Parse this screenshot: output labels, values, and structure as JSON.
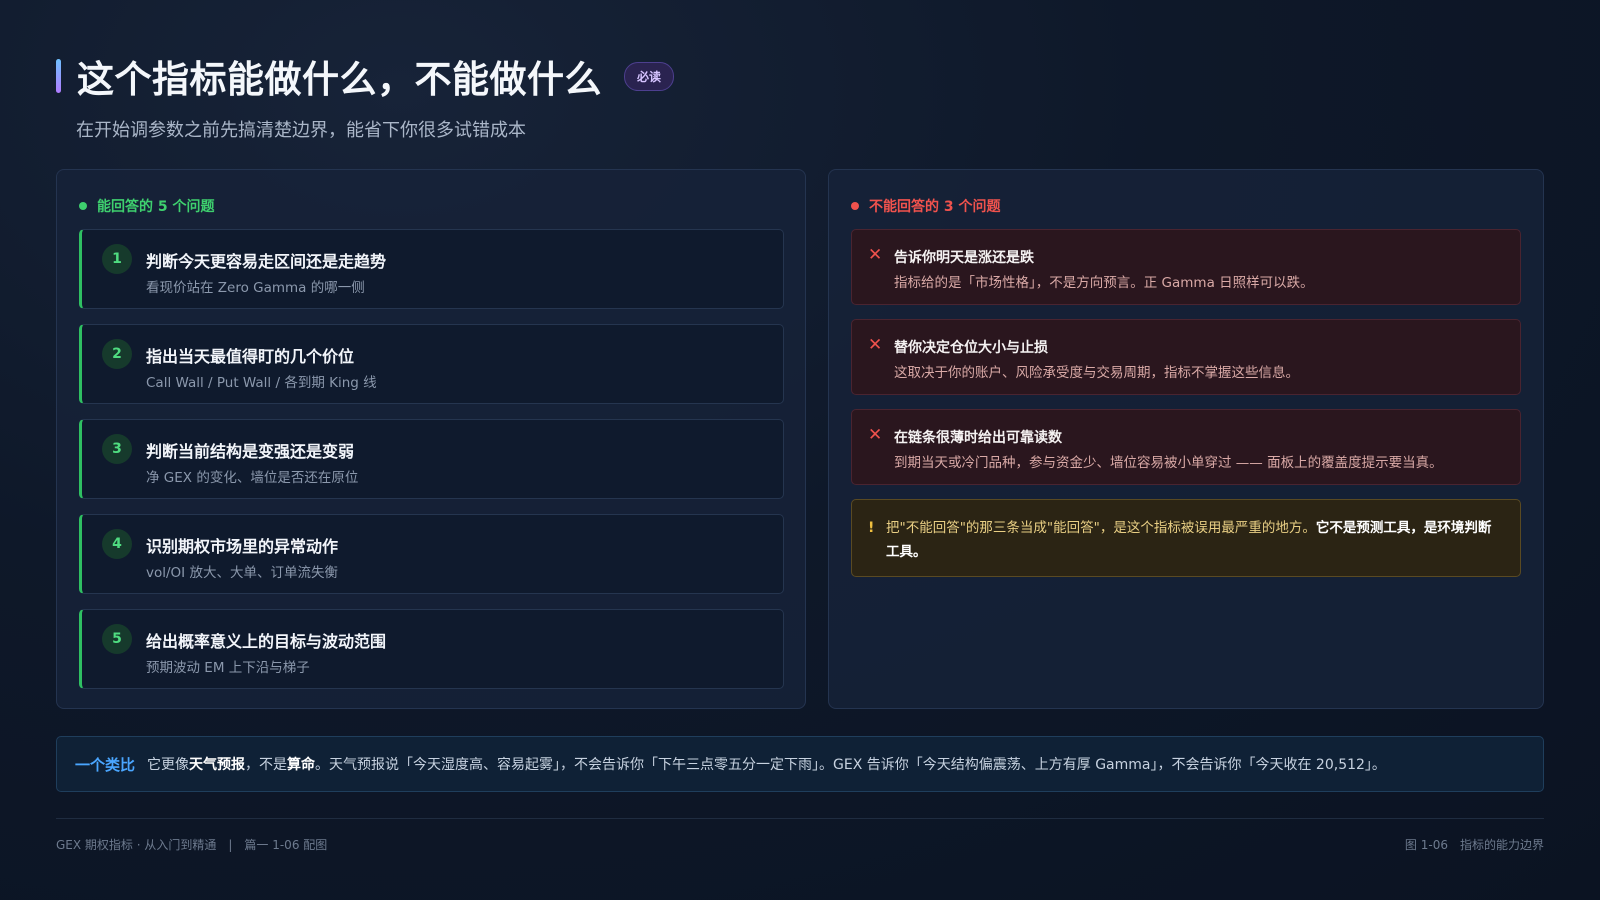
{
  "header": {
    "title": "这个指标能做什么，不能做什么",
    "badge": "必读",
    "subtitle": "在开始调参数之前先搞清楚边界，能省下你很多试错成本"
  },
  "can": {
    "heading": "能回答的 5 个问题",
    "color": "#3ecf6e",
    "items": [
      {
        "num": "1",
        "title": "判断今天更容易走区间还是走趋势",
        "desc": "看现价站在 Zero Gamma 的哪一侧"
      },
      {
        "num": "2",
        "title": "指出当天最值得盯的几个价位",
        "desc": "Call Wall / Put Wall / 各到期 King 线"
      },
      {
        "num": "3",
        "title": "判断当前结构是变强还是变弱",
        "desc": "净 GEX 的变化、墙位是否还在原位"
      },
      {
        "num": "4",
        "title": "识别期权市场里的异常动作",
        "desc": "vol/OI 放大、大单、订单流失衡"
      },
      {
        "num": "5",
        "title": "给出概率意义上的目标与波动范围",
        "desc": "预期波动 EM 上下沿与梯子"
      }
    ]
  },
  "cannot": {
    "heading": "不能回答的 3 个问题",
    "color": "#f0524d",
    "icon": "close-icon",
    "items": [
      {
        "title": "告诉你明天是涨还是跌",
        "desc": "指标给的是「市场性格」，不是方向预言。正 Gamma 日照样可以跌。"
      },
      {
        "title": "替你决定仓位大小与止损",
        "desc": "这取决于你的账户、风险承受度与交易周期，指标不掌握这些信息。"
      },
      {
        "title": "在链条很薄时给出可靠读数",
        "desc": "到期当天或冷门品种，参与资金少、墙位容易被小单穿过 —— 面板上的覆盖度提示要当真。"
      }
    ],
    "warning": {
      "icon": "!",
      "text": "把\"不能回答\"的那三条当成\"能回答\"，是这个指标被误用最严重的地方。",
      "strong": "它不是预测工具，是环境判断工具。"
    }
  },
  "analogy": {
    "label": "一个类比",
    "t1": "它更像",
    "b1": "天气预报",
    "t2": "，不是",
    "b2": "算命",
    "t3": "。天气预报说「今天湿度高、容易起雾」，不会告诉你「下午三点零五分一定下雨」。GEX 告诉你「今天结构偏震荡、上方有厚 Gamma」，不会告诉你「今天收在 20,512」。"
  },
  "footer": {
    "left": "GEX 期权指标 · 从入门到精通　|　篇一 1-06 配图",
    "figure": "图 1-06",
    "caption": "指标的能力边界"
  }
}
